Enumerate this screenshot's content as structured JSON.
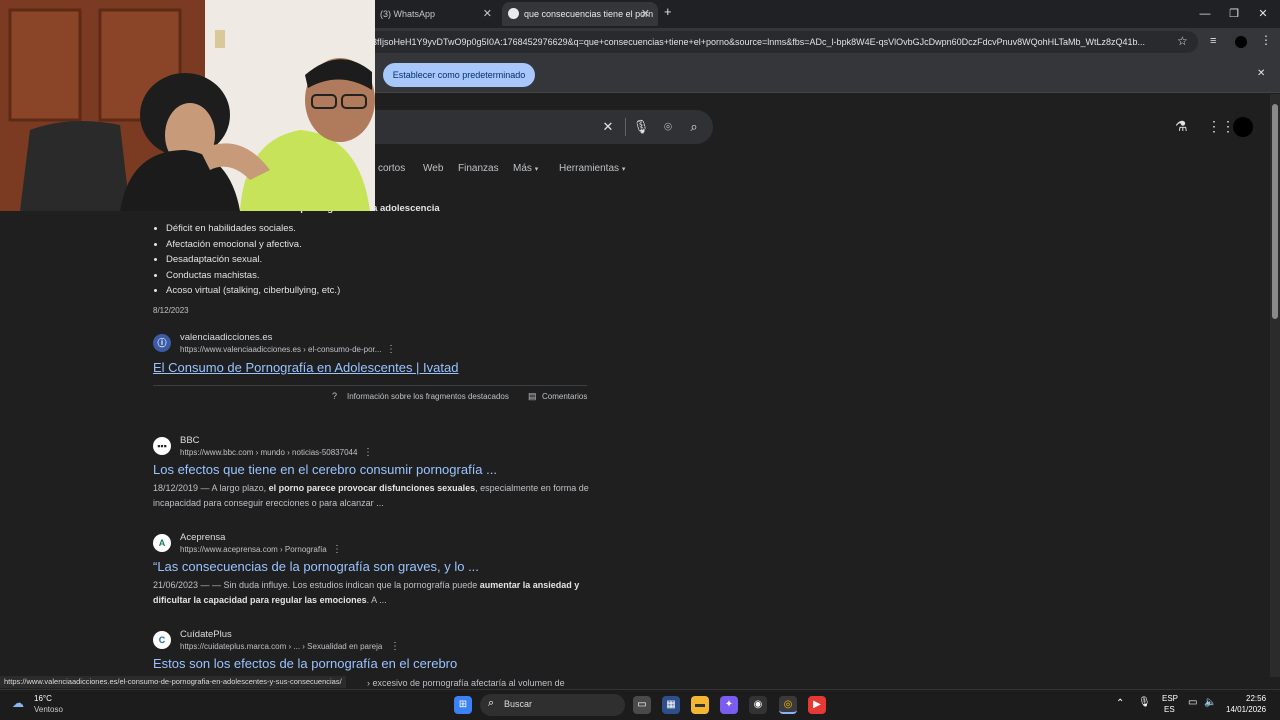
{
  "browser": {
    "tabs": [
      {
        "label": "(3) WhatsApp",
        "active": false
      },
      {
        "label": "que consecuencias tiene el porn",
        "active": true
      }
    ],
    "new_tab": "+",
    "address": "3fIjsoHeH1Y9yvDTwO9p0g5I0A:1768452976629&q=que+consecuencias+tiene+el+porno&source=lnms&fbs=ADc_l-bpk8W4E-qsVlOvbGJcDwpn60DczFdcvPnuv8WQohHLTaMb_WtLz8zQ41b...",
    "set_default_label": "Establecer como predeterminado",
    "window_controls": {
      "minimize": "—",
      "maximize": "❐",
      "close": "✕"
    }
  },
  "search_nav": {
    "tabs": [
      "cortos",
      "Web",
      "Finanzas",
      "Más",
      "Herramientas"
    ]
  },
  "snippet": {
    "heading": "Consecuencias del consumo de pornografía en la adolescencia",
    "bullets": [
      "Déficit en habilidades sociales.",
      "Afectación emocional y afectiva.",
      "Desadaptación sexual.",
      "Conductas machistas.",
      "Acoso virtual (stalking, ciberbullying, etc.)"
    ],
    "date": "8/12/2023",
    "site": "valenciaadicciones.es",
    "url": "https://www.valenciaadicciones.es › el-consumo-de-por...",
    "title": "El Consumo de Pornografía en Adolescentes | Ivatad",
    "about": "Información sobre los fragmentos destacados",
    "feedback": "Comentarios"
  },
  "results": [
    {
      "site": "BBC",
      "favicon": "BBC",
      "url": "https://www.bbc.com › mundo › noticias-50837044",
      "title": "Los efectos que tiene en el cerebro consumir pornografía ...",
      "snippet_prefix": "18/12/2019 — A largo plazo, ",
      "snippet_bold": "el porno parece provocar disfunciones sexuales",
      "snippet_suffix": ", especialmente en forma de incapacidad para conseguir erecciones o para alcanzar ..."
    },
    {
      "site": "Aceprensa",
      "favicon": "A",
      "url": "https://www.aceprensa.com › Pornografía",
      "title": "“Las consecuencias de la pornografía son graves, y lo ...",
      "snippet_prefix": "21/06/2023 — — Sin duda influye. Los estudios indican que la pornografía puede ",
      "snippet_bold": "aumentar la ansiedad y dificultar la capacidad para regular las emociones",
      "snippet_suffix": ". A ..."
    },
    {
      "site": "CuídatePlus",
      "favicon": "C",
      "url": "https://cuidateplus.marca.com › ... › Sexualidad en pareja",
      "title": "Estos son los efectos de la pornografía en el cerebro",
      "snippet_prefix": "› excesivo de pornografía afectaría al volumen de",
      "snippet_bold": "",
      "snippet_suffix": ""
    }
  ],
  "status_url": "https://www.valenciaadicciones.es/el-consumo-de-pornografia-en-adolescentes-y-sus-consecuencias/",
  "taskbar": {
    "weather_temp": "16°C",
    "weather_desc": "Ventoso",
    "search_label": "Buscar",
    "lang_top": "ESP",
    "lang_bottom": "ES",
    "time": "22:56",
    "date": "14/01/2026"
  },
  "colors": {
    "link": "#99c3ff",
    "accent_button": "#a8c7fa"
  }
}
